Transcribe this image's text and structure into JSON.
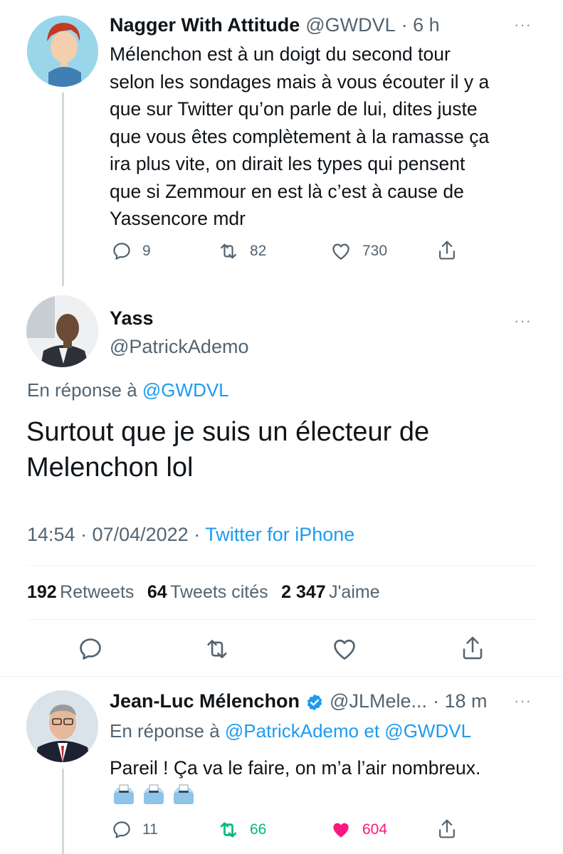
{
  "tweet1": {
    "name": "Nagger With Attitude",
    "handle": "@GWDVL",
    "time": "· 6 h",
    "text_lines": [
      "Mélenchon est à un doigt du second tour",
      "selon les sondages mais à vous écouter il y a",
      "que sur Twitter qu’on parle de lui, dites juste",
      "que vous êtes complètement à la ramasse ça",
      "ira plus vite, on dirait les types qui pensent",
      "que si Zemmour en est là c’est à cause de",
      "Yassencore mdr"
    ],
    "replies": "9",
    "retweets": "82",
    "likes": "730",
    "more_label": "···"
  },
  "main_tweet": {
    "name": "Yass",
    "handle": "@PatrickAdemo",
    "reply_prefix": "En réponse à",
    "reply_to": "@GWDVL",
    "text_lines": [
      "Surtout que je suis un électeur de",
      "Melenchon lol"
    ],
    "timestamp": "14:54 · 07/04/2022 ·",
    "source": "Twitter for iPhone",
    "stats": {
      "retweets_count": "192",
      "retweets_label": "Retweets",
      "quotes_count": "64",
      "quotes_label": "Tweets cités",
      "likes_count": "2 347",
      "likes_label": "J'aime"
    },
    "more_label": "···"
  },
  "tweet3": {
    "name": "Jean-Luc Mélenchon",
    "handle": "@JLMele...",
    "time": "· 18 m",
    "reply_prefix": "En réponse à",
    "reply_to_1": "@PatrickAdemo",
    "reply_and": "et",
    "reply_to_2": "@GWDVL",
    "text": "Pareil ! Ça va le faire, on m’a l’air nombreux.",
    "emoji_count": 3,
    "replies": "11",
    "retweets": "66",
    "likes": "604",
    "more_label": "···"
  },
  "colors": {
    "accent": "#1d9bf0",
    "retweet_active": "#00ba7c",
    "like_active": "#f91880",
    "muted": "#536471"
  }
}
